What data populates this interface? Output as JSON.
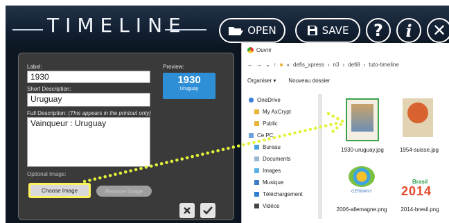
{
  "app": {
    "title": "TIMELINE",
    "toolbar": {
      "open_label": "OPEN",
      "save_label": "SAVE",
      "help_label": "?",
      "info_label": "i",
      "close_label": "✕"
    }
  },
  "form": {
    "label_caption": "Label:",
    "label_value": "1930",
    "short_caption": "Short Description:",
    "short_value": "Uruguay",
    "full_caption": "Full Description:",
    "full_note": "(This appears in the printout only)",
    "full_value": "Vainqueur : Uruguay",
    "preview_caption": "Preview:",
    "preview_year": "1930",
    "preview_desc": "Uruguay",
    "image_caption": "Optional Image:",
    "choose_label": "Choose Image",
    "remove_label": "Remove Image"
  },
  "dialog": {
    "title": "Ouvrir",
    "path": [
      "defis_xpress",
      "n3",
      "defi8",
      "tuto-timeline"
    ],
    "organize_label": "Organiser ▾",
    "new_folder_label": "Nouveau dossier",
    "nav_items": [
      "OneDrive",
      "My AxCrypt",
      "Public",
      "Ce PC",
      "Bureau",
      "Documents",
      "Images",
      "Musique",
      "Téléchargement",
      "Vidéos"
    ],
    "files": [
      "1930-uruguay.jpg",
      "1954-suisse.jpg",
      "2006-allemagne.png",
      "2014-bresil.png"
    ],
    "thumb_texts": {
      "germany": "GERMANY",
      "brasil_word": "Brasil",
      "brasil_year": "2014"
    }
  },
  "colors": {
    "accent": "#2e8fd6",
    "highlight": "#fbf25d",
    "arrow": "#e3f23a"
  }
}
